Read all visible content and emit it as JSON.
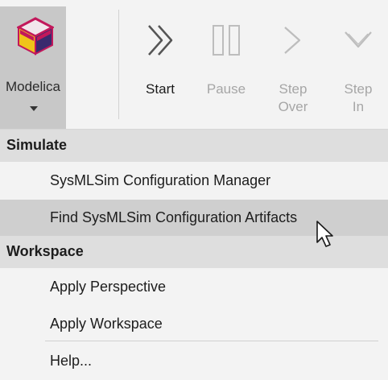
{
  "ribbon": {
    "modelica": {
      "label": "Modelica",
      "icon": "modelica-cube-icon"
    },
    "start": {
      "label": "Start",
      "icon": "start-icon",
      "enabled": true
    },
    "pause": {
      "label": "Pause",
      "icon": "pause-icon",
      "enabled": false
    },
    "step_over": {
      "line1": "Step",
      "line2": "Over",
      "icon": "step-over-icon",
      "enabled": false
    },
    "step_in": {
      "line1": "Step",
      "line2": "In",
      "icon": "step-in-icon",
      "enabled": false
    }
  },
  "menu": {
    "sections": [
      {
        "header": "Simulate",
        "items": [
          "SysMLSim Configuration Manager",
          "Find SysMLSim Configuration Artifacts"
        ]
      },
      {
        "header": "Workspace",
        "items": [
          "Apply Perspective",
          "Apply Workspace"
        ]
      }
    ],
    "help": "Help...",
    "highlighted": "Find SysMLSim Configuration Artifacts"
  },
  "colors": {
    "background": "#f3f3f3",
    "header_bg": "#dedede",
    "hover_bg": "#cfcfcf",
    "modelica_bg": "#c8c8c8",
    "cube_magenta": "#c2185b",
    "cube_yellow": "#f0c419",
    "cube_purple": "#3a2a6e"
  }
}
